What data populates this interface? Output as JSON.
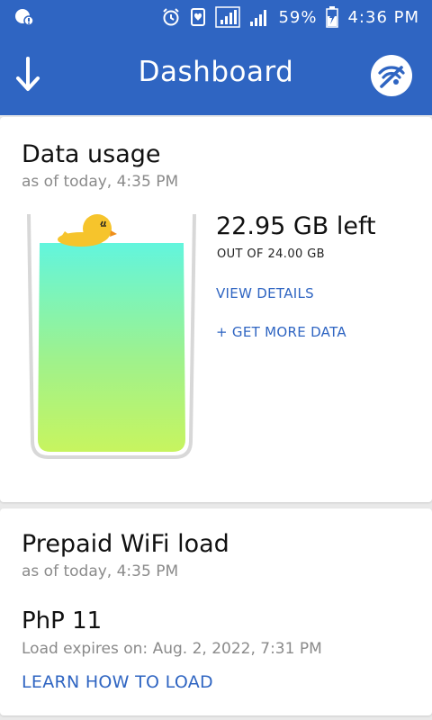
{
  "status_bar": {
    "battery": "59%",
    "time": "4:36 PM",
    "icons": [
      "notification-icon",
      "alarm-icon",
      "vibrate-icon",
      "signal-icon",
      "signal-icon",
      "battery-charging-icon"
    ]
  },
  "app_bar": {
    "title": "Dashboard",
    "back_icon": "arrow-down-icon",
    "logo_icon": "wifi-logo-icon",
    "color": "#2f65c2"
  },
  "data_usage": {
    "title": "Data usage",
    "subtitle": "as of today, 4:35 PM",
    "remaining": "22.95 GB left",
    "total": "OUT OF 24.00 GB",
    "remaining_fraction": 0.956,
    "view_details": "VIEW DETAILS",
    "get_more": "+ GET MORE DATA"
  },
  "prepaid": {
    "title": "Prepaid WiFi load",
    "subtitle": "as of today, 4:35 PM",
    "amount": "PhP 11",
    "expires": "Load expires on: Aug. 2, 2022, 7:31 PM",
    "learn_link": "LEARN HOW TO LOAD"
  }
}
